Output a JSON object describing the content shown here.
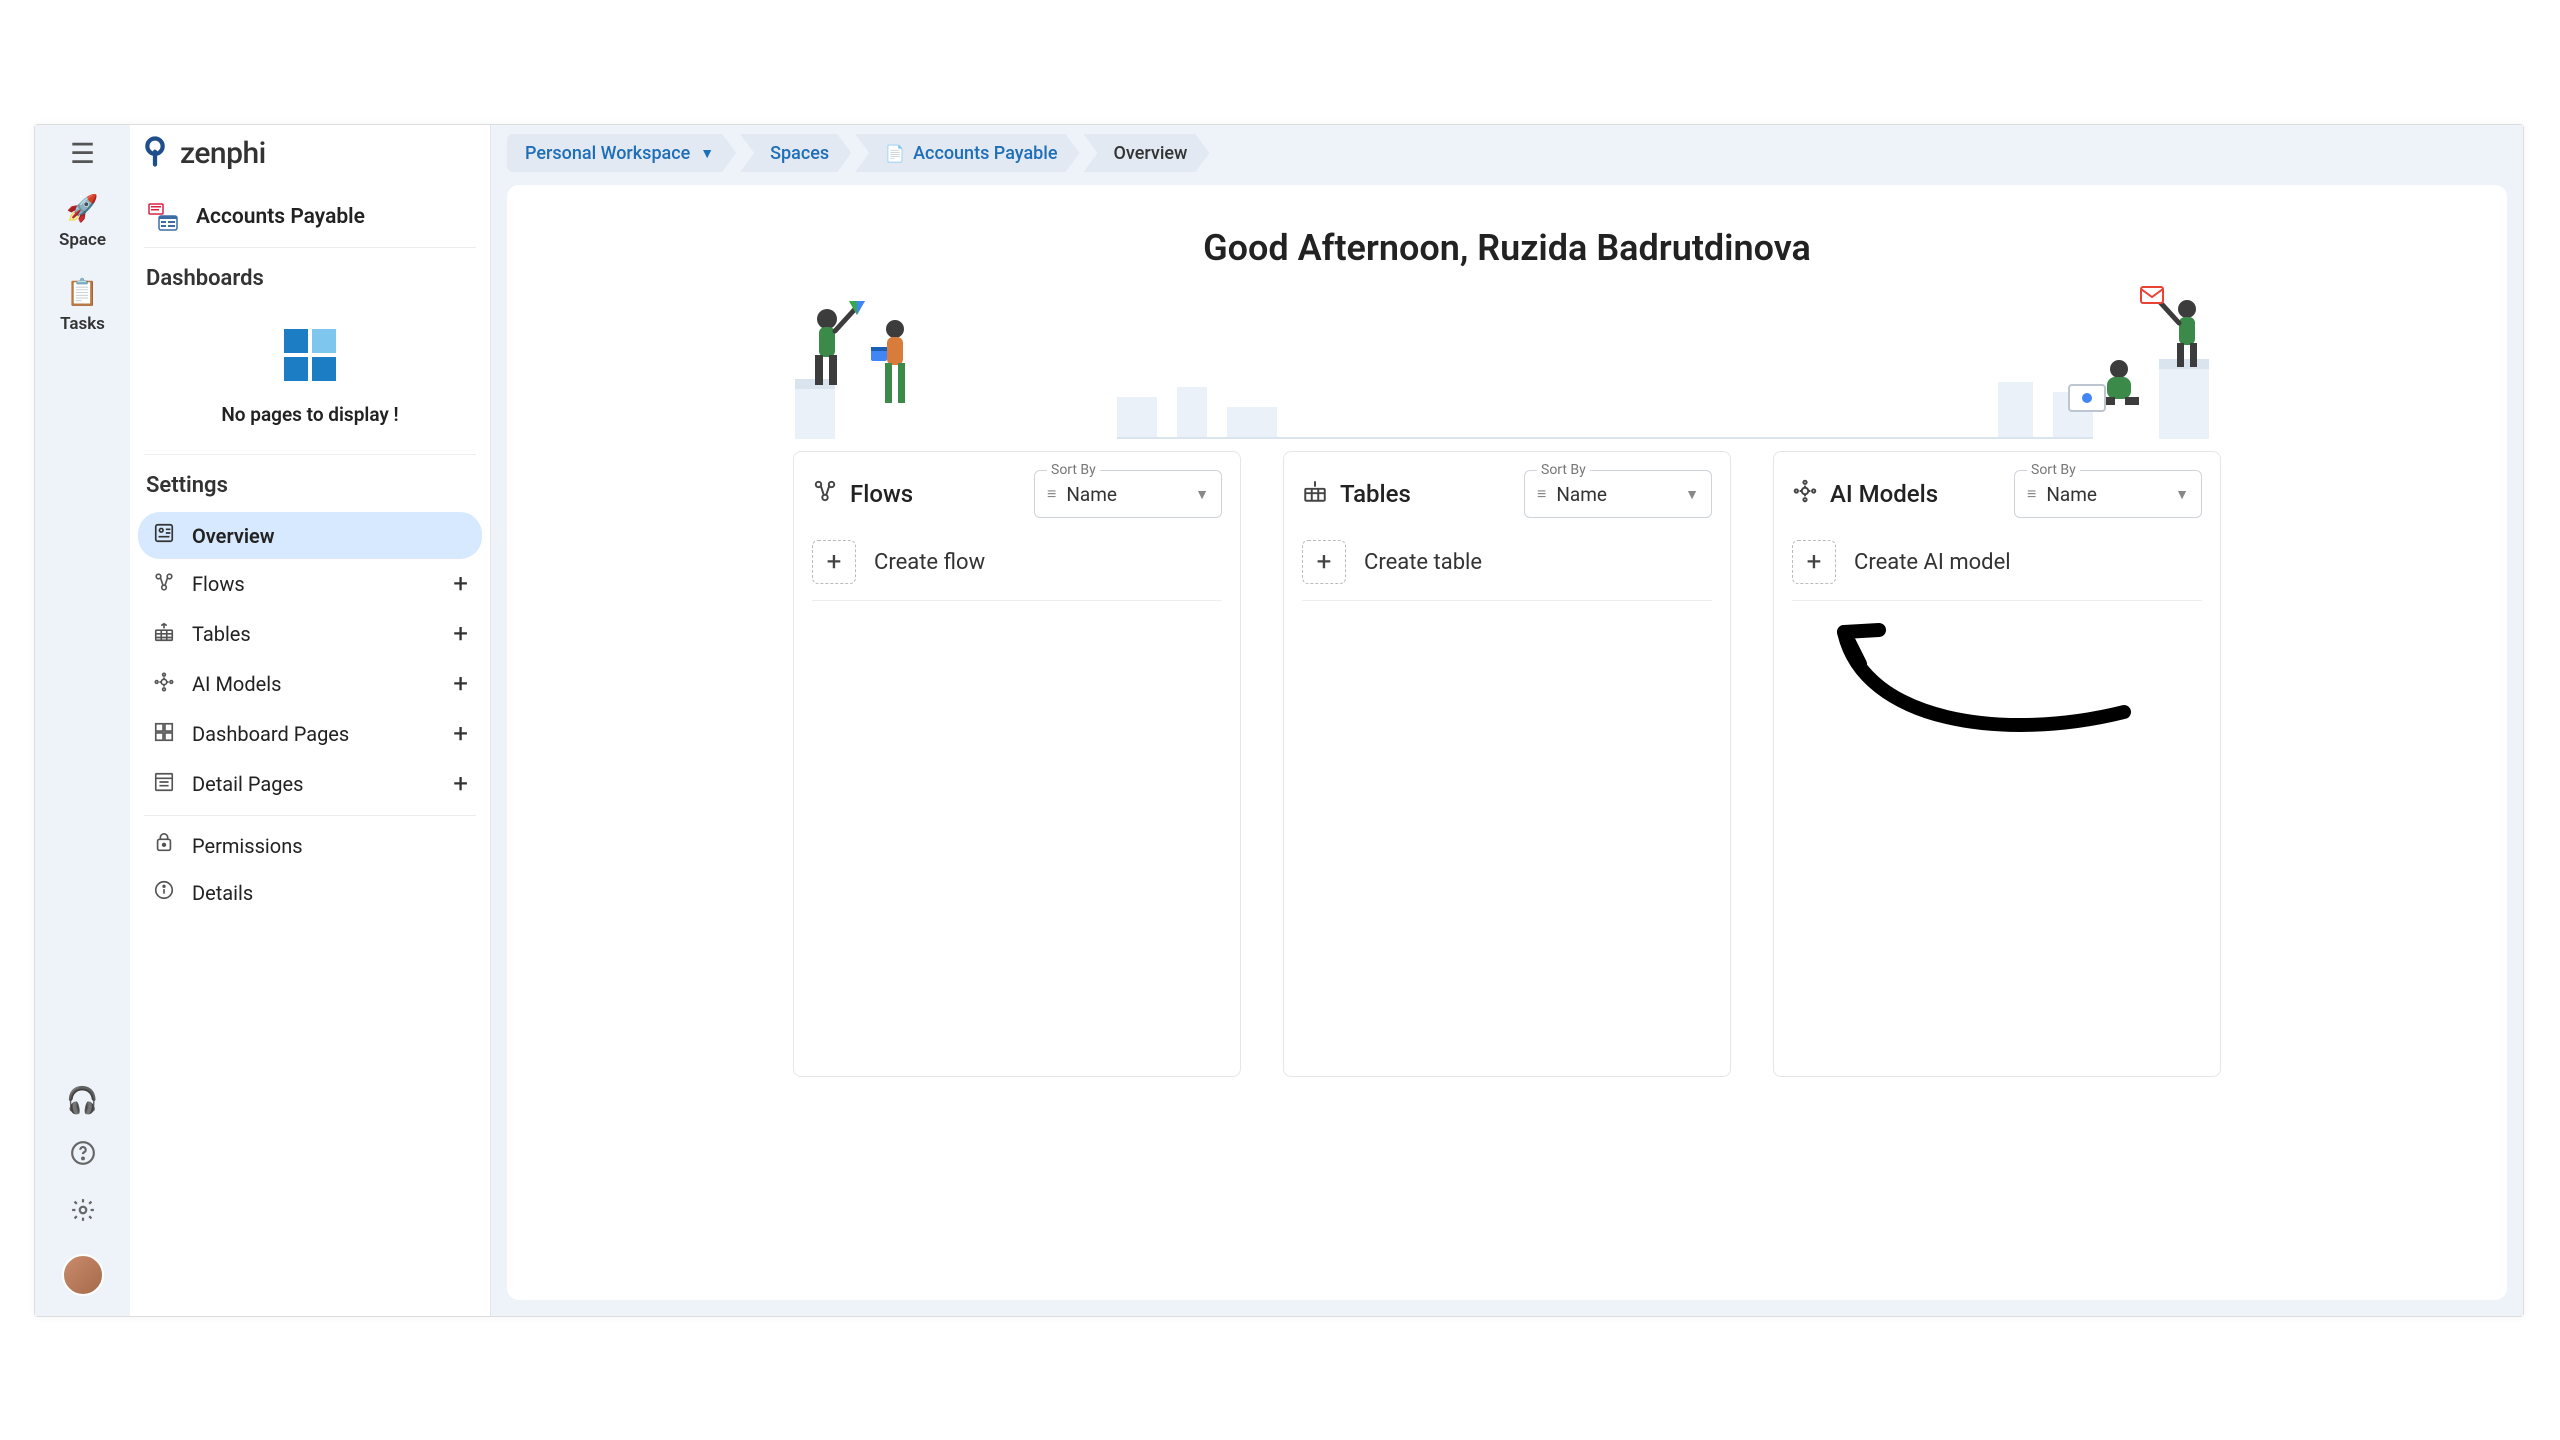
{
  "brand": {
    "name": "zenphi"
  },
  "rail": {
    "items": [
      {
        "label": "Space"
      },
      {
        "label": "Tasks"
      }
    ]
  },
  "breadcrumbs": {
    "workspace": "Personal Workspace",
    "spaces": "Spaces",
    "current_space": "Accounts Payable",
    "page": "Overview"
  },
  "sidebar": {
    "space_title": "Accounts Payable",
    "dashboards_heading": "Dashboards",
    "dashboards_empty": "No pages to display !",
    "settings_heading": "Settings",
    "items": [
      {
        "label": "Overview",
        "has_add": false,
        "active": true
      },
      {
        "label": "Flows",
        "has_add": true
      },
      {
        "label": "Tables",
        "has_add": true
      },
      {
        "label": "AI Models",
        "has_add": true
      },
      {
        "label": "Dashboard Pages",
        "has_add": true
      },
      {
        "label": "Detail Pages",
        "has_add": true
      },
      {
        "label": "Permissions",
        "has_add": false
      },
      {
        "label": "Details",
        "has_add": false
      }
    ]
  },
  "main": {
    "greeting": "Good Afternoon, Ruzida Badrutdinova",
    "sort_label": "Sort By",
    "cards": [
      {
        "title": "Flows",
        "sort": "Name",
        "create": "Create flow"
      },
      {
        "title": "Tables",
        "sort": "Name",
        "create": "Create table"
      },
      {
        "title": "AI Models",
        "sort": "Name",
        "create": "Create AI model"
      }
    ]
  }
}
